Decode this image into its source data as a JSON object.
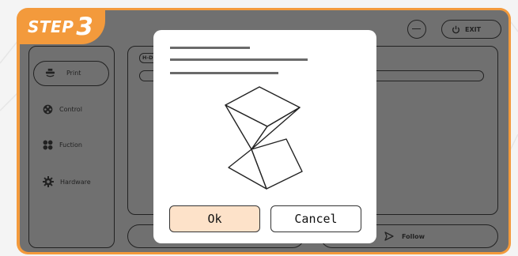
{
  "step": {
    "word": "STEP",
    "number": "3"
  },
  "header": {
    "exit_label": "EXIT",
    "minus_icon": "minus-circle-icon",
    "power_icon": "power-icon"
  },
  "sidebar": {
    "items": [
      {
        "label": "Print",
        "icon": "printer-icon"
      },
      {
        "label": "Control",
        "icon": "control-icon"
      },
      {
        "label": "Fuction",
        "icon": "four-petal-icon"
      },
      {
        "label": "Hardware",
        "icon": "gear-icon"
      }
    ]
  },
  "main": {
    "tab_label": "H-D"
  },
  "bottom": {
    "follow_label": "Follow",
    "follow_icon": "send-icon"
  },
  "dialog": {
    "ok_label": "Ok",
    "cancel_label": "Cancel",
    "illustration_icon": "twisted-cube-icon"
  },
  "colors": {
    "accent": "#f39a3c",
    "screen": "#707070",
    "ok_fill": "#fde2c9"
  }
}
